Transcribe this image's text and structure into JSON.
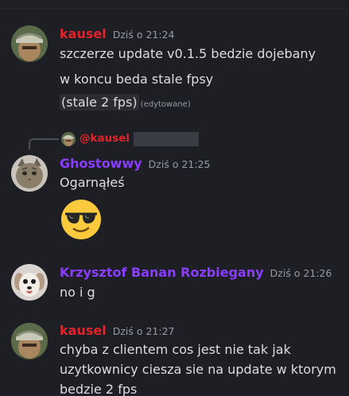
{
  "colors": {
    "background": "#1e1f24",
    "kausel": "#e0242c",
    "purple": "#8b3dff",
    "timestamp": "#949ba4",
    "text": "#dbdee1"
  },
  "messages": [
    {
      "username": "kausel",
      "timestamp": "Dziś o 21:24",
      "avatar": "soldier-avatar",
      "lines": [
        "szczerze update v0.1.5 bedzie dojebany",
        "w koncu beda stale fpsy",
        "(stale 2 fps)"
      ],
      "edited_label": "(edytowane)"
    },
    {
      "reply_to": "@kausel",
      "username": "Ghostowwy",
      "timestamp": "Dziś o 21:25",
      "avatar": "cat-avatar",
      "lines": [
        "Ogarnąłeś"
      ],
      "emoji": "sunglasses-emoji"
    },
    {
      "username": "Krzysztof Banan Rozbiegany",
      "timestamp": "Dziś o 21:26",
      "avatar": "dog-avatar",
      "lines": [
        "no i g"
      ]
    },
    {
      "username": "kausel",
      "timestamp": "Dziś o 21:27",
      "avatar": "soldier-avatar",
      "lines": [
        "chyba z clientem cos jest nie tak jak",
        "uzytkownicy ciesza sie na update w ktorym",
        "bedzie 2 fps"
      ]
    }
  ]
}
